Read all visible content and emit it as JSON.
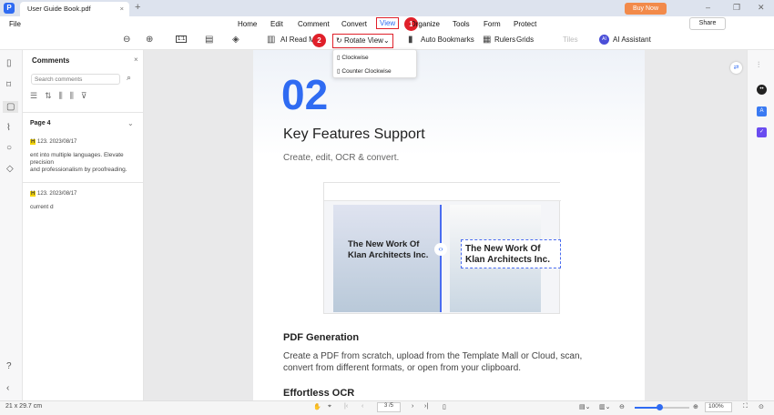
{
  "window": {
    "tab_title": "User Guide Book.pdf",
    "buy_now": "Buy Now",
    "close": "×",
    "plus": "+"
  },
  "menu": {
    "file": "File",
    "items": [
      "Home",
      "Edit",
      "Comment",
      "Convert",
      "View",
      "Organize",
      "Tools",
      "Form",
      "Protect"
    ],
    "share": "Share"
  },
  "toolbar": {
    "zoom_ratio": "1:1",
    "ai_read": "AI Read M",
    "rotate_view": "Rotate View",
    "auto_bookmarks": "Auto Bookmarks",
    "rulers": "Rulers",
    "grids": "Grids",
    "tiles": "Tiles",
    "ai_assistant": "AI Assistant"
  },
  "badges": [
    "1",
    "2"
  ],
  "rotate_menu": [
    "Clockwise",
    "Counter Clockwise"
  ],
  "comments": {
    "title": "Comments",
    "search_placeholder": "Search comments",
    "page": "Page 4",
    "items": [
      {
        "badge": "H",
        "meta": "123.  2023/08/17",
        "text1": "ent into multiple languages. Elevate precision",
        "text2": "and professionalism by proofreading."
      },
      {
        "badge": "H",
        "meta": "123.  2023/08/17",
        "text1": "current d",
        "text2": ""
      }
    ]
  },
  "doc": {
    "number": "02",
    "heading": "Key Features Support",
    "subtitle": "Create, edit, OCR & convert.",
    "image_heading_left": "The New Work Of Klan Architects Inc.",
    "image_heading_right": "The New Work Of Klan Architects Inc.",
    "section1": "PDF Generation",
    "para1a": "Create a PDF from scratch, upload from the Template Mall or Cloud, scan,",
    "para1b": "convert from different formats, or open from your clipboard.",
    "section2": "Effortless OCR"
  },
  "status": {
    "page_size": "21 x 29.7 cm",
    "page_input": "3 /5",
    "zoom": "100%",
    "zoom_level": 0.45
  },
  "colors": {
    "accent": "#2f6bf2",
    "highlight": "#e0202a"
  }
}
